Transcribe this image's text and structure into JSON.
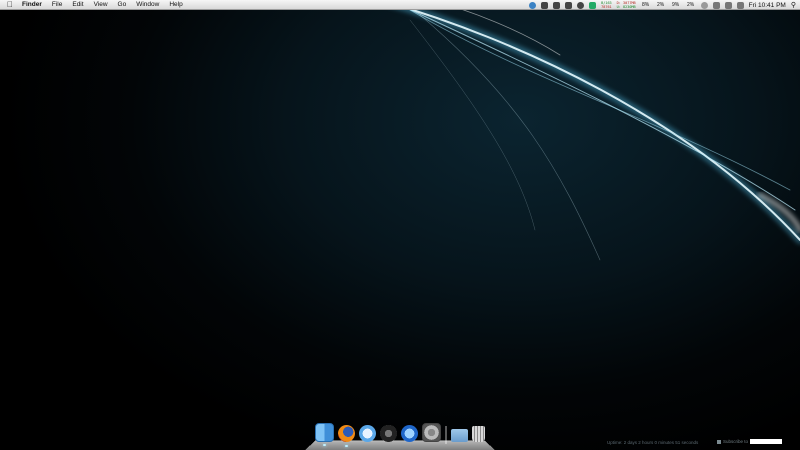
{
  "menubar": {
    "apple_icon": "apple-icon",
    "app_name": "Finder",
    "menus": [
      "File",
      "Edit",
      "View",
      "Go",
      "Window",
      "Help"
    ],
    "status": {
      "net_up": "B/163",
      "net_down": "78761",
      "net_up2": "D: 3077MB",
      "net_down2": "U: 8230MB",
      "meters": [
        "8%",
        "2%",
        "9%",
        "2%"
      ],
      "clock": "Fri 10:41 PM"
    }
  },
  "dock": {
    "items": [
      {
        "name": "finder",
        "icon": "finder-icon"
      },
      {
        "name": "firefox",
        "icon": "firefox-icon"
      },
      {
        "name": "mail",
        "icon": "mail-icon"
      },
      {
        "name": "dashboard",
        "icon": "dashboard-icon"
      },
      {
        "name": "itunes",
        "icon": "itunes-icon"
      },
      {
        "name": "system-preferences",
        "icon": "system-preferences-icon"
      },
      {
        "name": "downloads",
        "icon": "folder-icon"
      },
      {
        "name": "trash",
        "icon": "trash-icon"
      }
    ]
  },
  "widgets": {
    "uptime_text": "Uptime: 2 days 2 hours 0 minutes 51 seconds",
    "subscriber_label": "Subscribe to "
  },
  "colors": {
    "menubar": "#e8e8e8",
    "wallpaper": "#06141b",
    "accent_glow": "#bfefff"
  }
}
